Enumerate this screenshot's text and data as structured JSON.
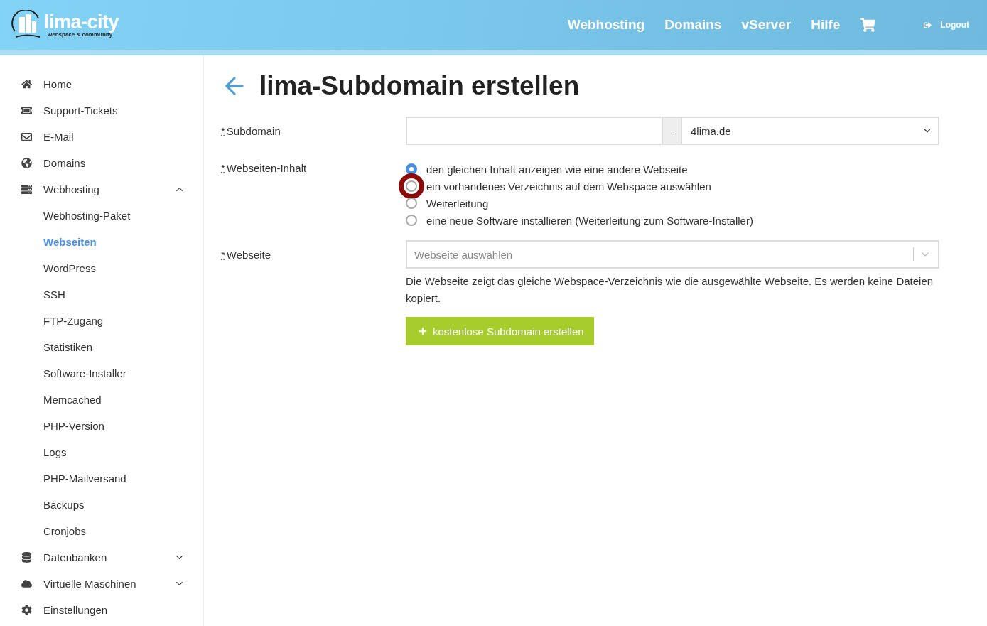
{
  "header": {
    "logo": {
      "name": "lima-city",
      "tagline": "webspace & community"
    },
    "nav": [
      {
        "label": "Webhosting",
        "kind": "text"
      },
      {
        "label": "Domains",
        "kind": "text"
      },
      {
        "label": "vServer",
        "kind": "text"
      },
      {
        "label": "Hilfe",
        "kind": "text"
      },
      {
        "kind": "cart"
      }
    ],
    "logout": "Logout"
  },
  "sidebar": {
    "items": [
      {
        "label": "Home"
      },
      {
        "label": "Support-Tickets"
      },
      {
        "label": "E-Mail"
      },
      {
        "label": "Domains"
      },
      {
        "label": "Webhosting",
        "expanded": true,
        "children": [
          {
            "label": "Webhosting-Paket",
            "selected": false
          },
          {
            "label": "Webseiten",
            "selected": true
          },
          {
            "label": "WordPress",
            "selected": false
          },
          {
            "label": "SSH",
            "selected": false
          },
          {
            "label": "FTP-Zugang",
            "selected": false
          },
          {
            "label": "Statistiken",
            "selected": false
          },
          {
            "label": "Software-Installer",
            "selected": false
          },
          {
            "label": "Memcached",
            "selected": false
          },
          {
            "label": "PHP-Version",
            "selected": false
          },
          {
            "label": "Logs",
            "selected": false
          },
          {
            "label": "PHP-Mailversand",
            "selected": false
          },
          {
            "label": "Backups",
            "selected": false
          },
          {
            "label": "Cronjobs",
            "selected": false
          }
        ]
      },
      {
        "label": "Datenbanken",
        "expanded": false
      },
      {
        "label": "Virtuelle Maschinen",
        "expanded": false
      },
      {
        "label": "Einstellungen"
      }
    ]
  },
  "page": {
    "title": "lima-Subdomain erstellen",
    "form": {
      "subdomain": {
        "label": "Subdomain",
        "required_mark": "*",
        "separator": ".",
        "domain": "4lima.de"
      },
      "content": {
        "label": "Webseiten-Inhalt",
        "required_mark": "*",
        "options": [
          {
            "label": "den gleichen Inhalt anzeigen wie eine andere Webseite",
            "selected": true,
            "highlighted": false
          },
          {
            "label": "ein vorhandenes Verzeichnis auf dem Webspace auswählen",
            "selected": false,
            "highlighted": true
          },
          {
            "label": "Weiterleitung",
            "selected": false,
            "highlighted": false
          },
          {
            "label": "eine neue Software installieren (Weiterleitung zum Software-Installer)",
            "selected": false,
            "highlighted": false
          }
        ]
      },
      "website": {
        "label": "Webseite",
        "required_mark": "*",
        "placeholder": "Webseite auswählen",
        "help": "Die Webseite zeigt das gleiche Webspace-Verzeichnis wie die ausgewählte Webseite. Es werden keine Dateien kopiert."
      },
      "submit": "kostenlose Subdomain erstellen"
    }
  }
}
